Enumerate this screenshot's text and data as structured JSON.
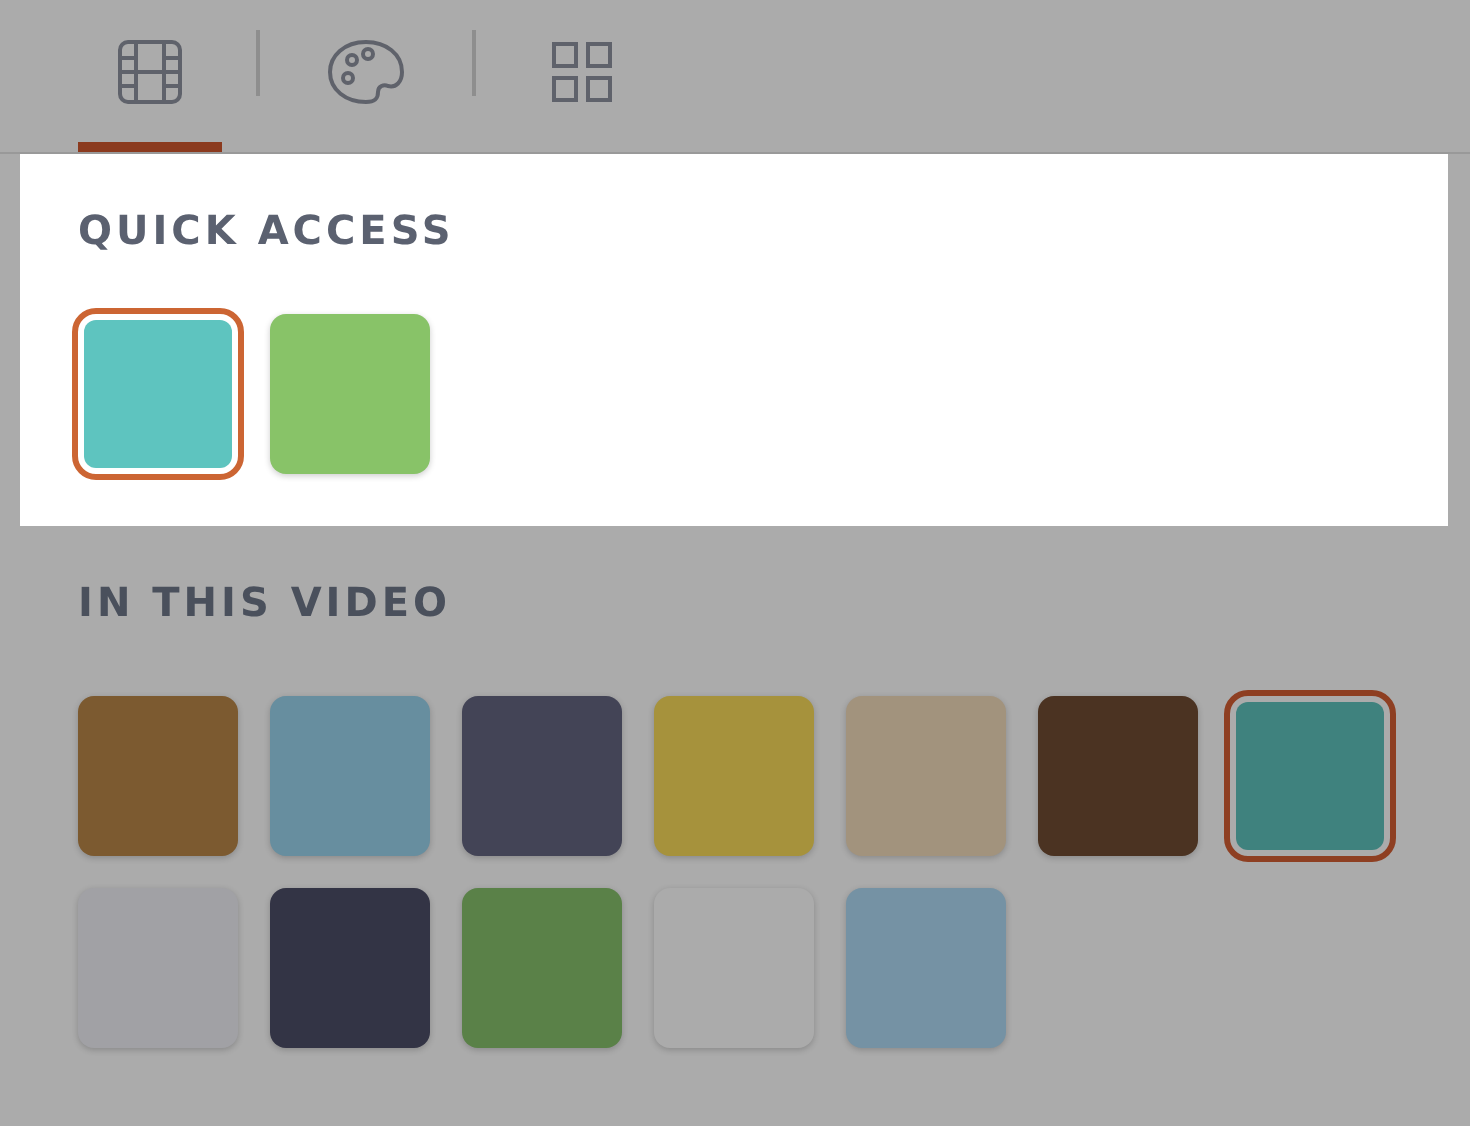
{
  "tabs": [
    {
      "kind": "film",
      "selected": true
    },
    {
      "kind": "palette",
      "selected": false
    },
    {
      "kind": "grid",
      "selected": false
    }
  ],
  "sections": [
    {
      "title": "QUICK ACCESS",
      "highlighted": true,
      "swatches": [
        {
          "color": "#5ec4bf",
          "selected": true
        },
        {
          "color": "#88c368",
          "selected": false
        }
      ]
    },
    {
      "title": "IN THIS VIDEO",
      "highlighted": false,
      "swatches": [
        {
          "color": "#7c5a30",
          "selected": false
        },
        {
          "color": "#678e9f",
          "selected": false
        },
        {
          "color": "#434456",
          "selected": false
        },
        {
          "color": "#a6923c",
          "selected": false
        },
        {
          "color": "#a2937d",
          "selected": false
        },
        {
          "color": "#4b3322",
          "selected": false
        },
        {
          "color": "#3f827e",
          "selected": true
        },
        {
          "color": "#a1a1a5",
          "selected": false
        },
        {
          "color": "#333445",
          "selected": false
        },
        {
          "color": "#5a8148",
          "selected": false
        },
        {
          "color": "#ababab",
          "selected": false
        },
        {
          "color": "#7592a4",
          "selected": false
        }
      ]
    }
  ]
}
